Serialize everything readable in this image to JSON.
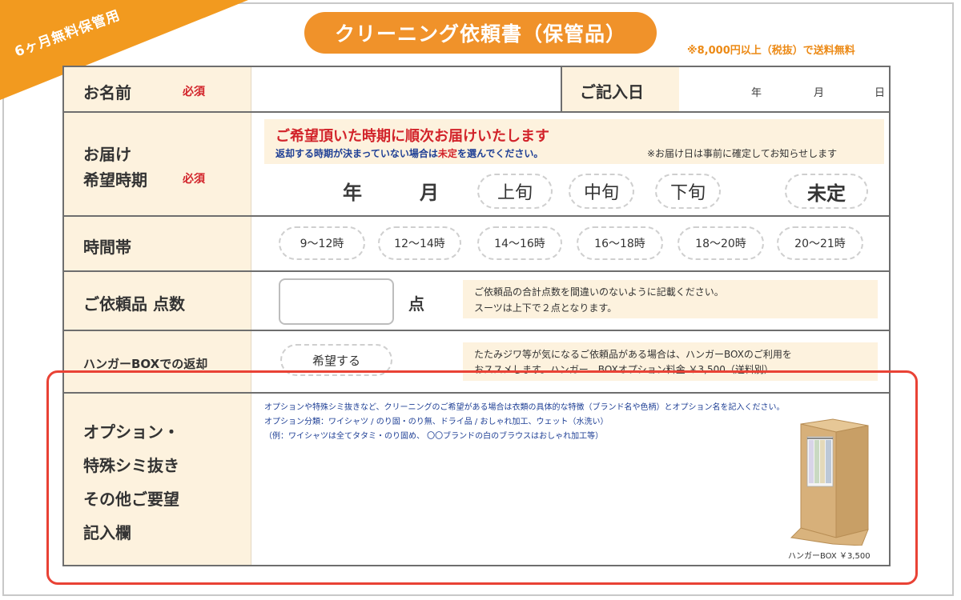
{
  "corner_label": "6ヶ月無料保管用",
  "title": "クリーニング依頼書（保管品）",
  "shipping_note": "※8,000円以上（税抜）で送料無料",
  "name_row": {
    "label": "お名前",
    "required": "必須",
    "date_label": "ご記入日",
    "year": "年",
    "month": "月",
    "day": "日"
  },
  "delivery_row": {
    "label_line1": "お届け",
    "label_line2": "希望時期",
    "required": "必須",
    "notice_title": "ご希望頂いた時期に順次お届けいたします",
    "notice_sub_a": "返却する時期が決まっていない場合は",
    "notice_sub_red": "未定",
    "notice_sub_b": "を選んでください。",
    "notice_right": "※お届け日は事前に確定してお知らせします",
    "year": "年",
    "month": "月",
    "options": [
      "上旬",
      "中旬",
      "下旬"
    ],
    "undecided": "未定"
  },
  "time_row": {
    "label": "時間帯",
    "slots": [
      "9〜12時",
      "12〜14時",
      "14〜16時",
      "16〜18時",
      "18〜20時",
      "20〜21時"
    ]
  },
  "count_row": {
    "label": "ご依頼品 点数",
    "unit": "点",
    "note_line1": "ご依頼品の合計点数を間違いのないように記載ください。",
    "note_line2": "スーツは上下で２点となります。"
  },
  "hanger_row": {
    "label": "ハンガーBOXでの返却",
    "button": "希望する",
    "note_line1": "たたみジワ等が気になるご依頼品がある場合は、ハンガーBOXのご利用を",
    "note_line2": "おススメします。ハンガー　BOXオプション料金 ￥3,500（送料別）"
  },
  "option_row": {
    "label_lines": [
      "オプション・",
      "特殊シミ抜き",
      "その他ご要望",
      "記入欄"
    ],
    "instructions": [
      "オプションや特殊シミ抜きなど、クリーニングのご希望がある場合は衣類の具体的な特徴（ブランド名や色柄）とオプション名を記入ください。",
      "オプション分類：ワイシャツ / のり固・のり無、ドライ品 / おしゃれ加工、ウェット（水洗い）",
      "（例：ワイシャツは全てタタミ・のり固め、 〇〇ブランドの白のブラウスはおしゃれ加工等）"
    ],
    "box_caption": "ハンガーBOX ￥3,500"
  },
  "colors": {
    "orange": "#f0922a",
    "label_bg": "#fdf2de",
    "required_red": "#d2232a",
    "highlight_red": "#e94235"
  }
}
